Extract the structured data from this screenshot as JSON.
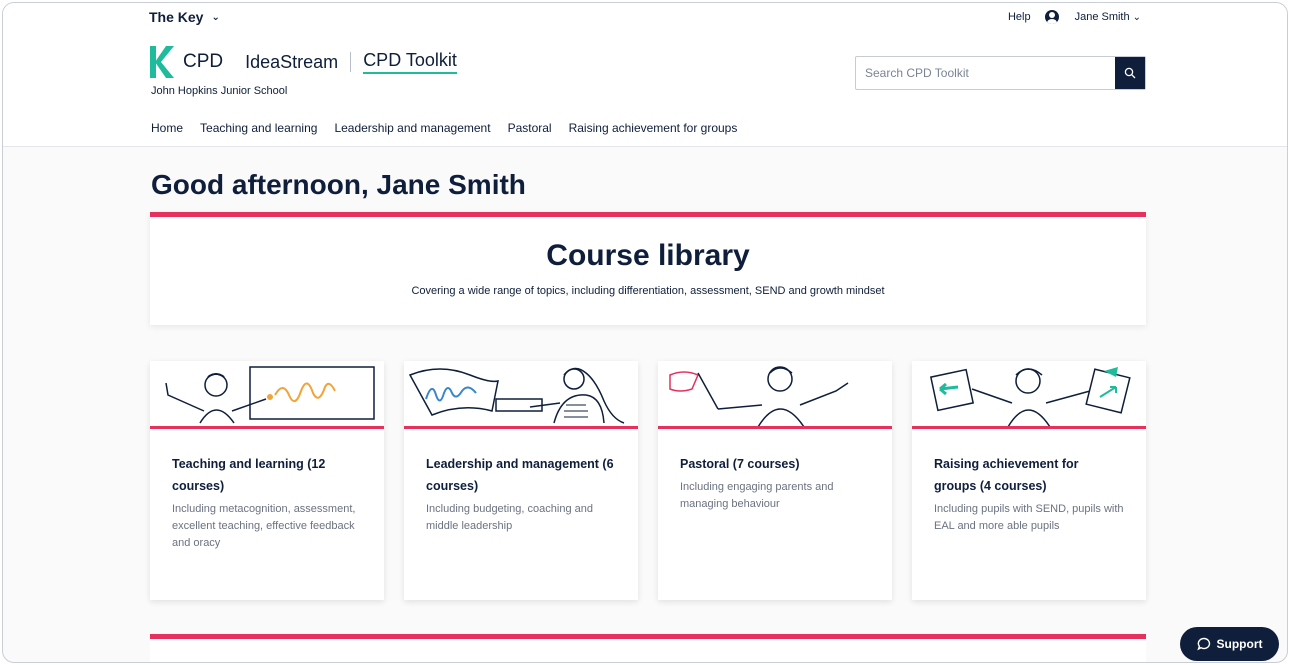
{
  "topbar": {
    "brand": "The Key",
    "help": "Help",
    "user": "Jane Smith"
  },
  "header": {
    "cpd": "CPD",
    "ideastream": "IdeaStream",
    "toolkit": "CPD Toolkit",
    "school": "John Hopkins Junior School",
    "search_placeholder": "Search CPD Toolkit"
  },
  "nav": [
    "Home",
    "Teaching and learning",
    "Leadership and management",
    "Pastoral",
    "Raising achievement for groups"
  ],
  "greeting": "Good afternoon, Jane Smith",
  "library": {
    "title": "Course library",
    "subtitle": "Covering a wide range of topics, including differentiation, assessment, SEND and growth mindset"
  },
  "cards": [
    {
      "title": "Teaching and learning (12 courses)",
      "description": "Including metacognition, assessment, excellent teaching, effective feedback and oracy"
    },
    {
      "title": "Leadership and management (6 courses)",
      "description": "Including budgeting, coaching and middle leadership"
    },
    {
      "title": "Pastoral (7 courses)",
      "description": "Including engaging parents and managing behaviour"
    },
    {
      "title": "Raising achievement for groups (4 courses)",
      "description": "Including pupils with SEND, pupils with EAL and more able pupils"
    }
  ],
  "support": "Support",
  "colors": {
    "navy": "#0f1e3a",
    "accent_pink": "#e6305e",
    "brand_green": "#1ebc9c"
  }
}
